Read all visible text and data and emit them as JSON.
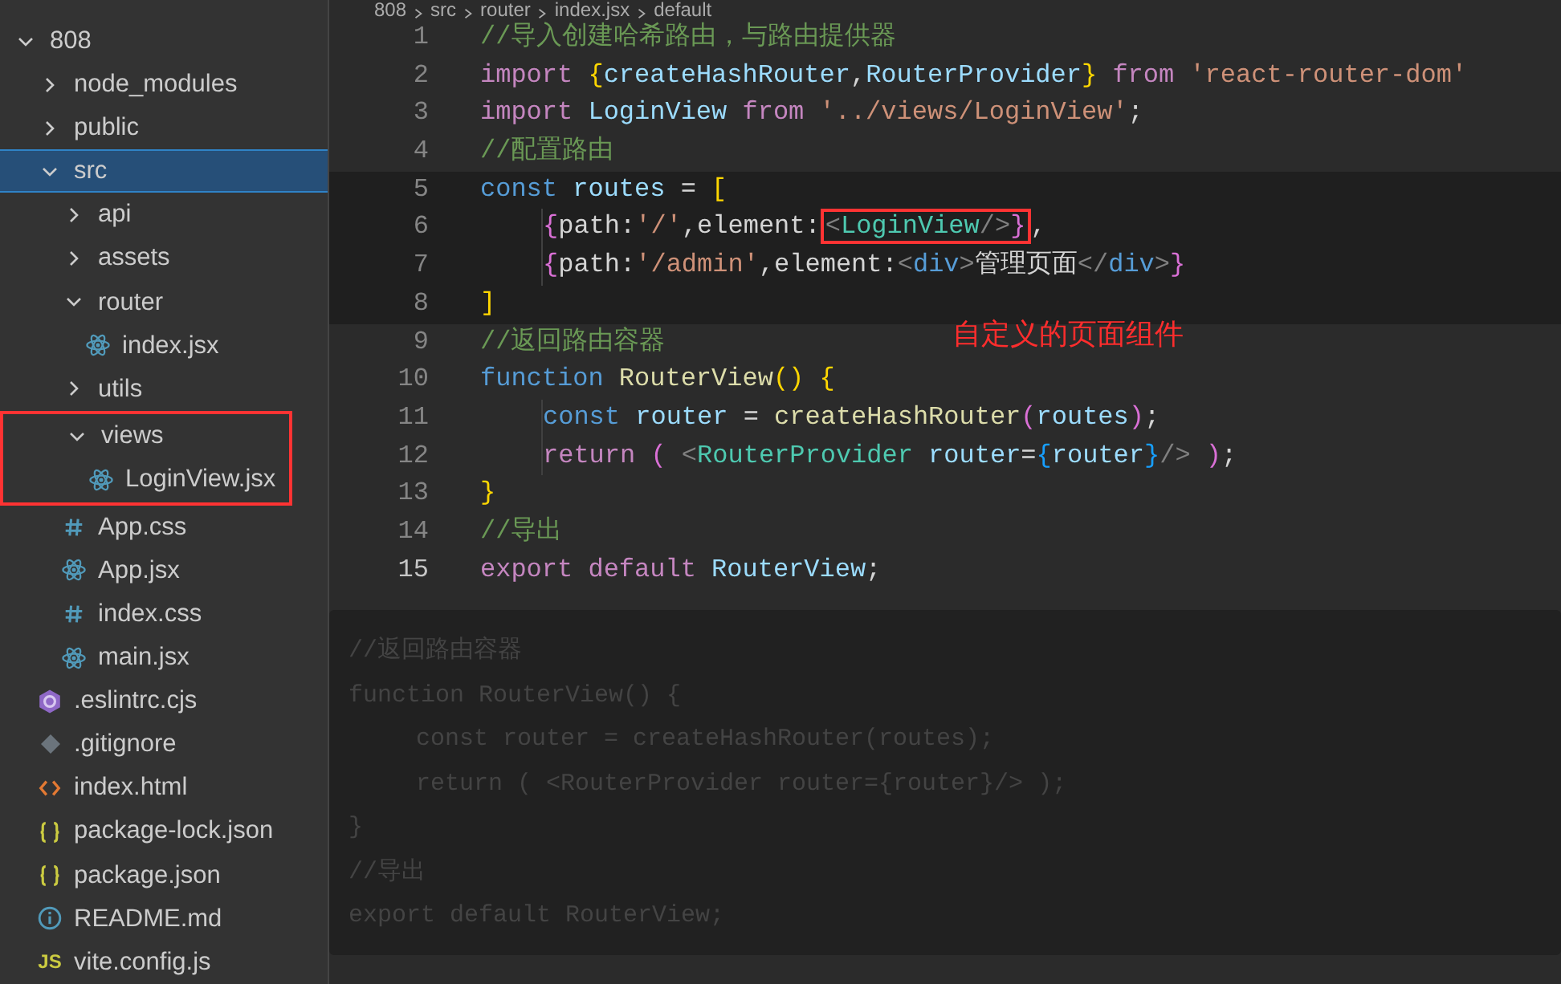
{
  "breadcrumb": [
    "808",
    "src",
    "router",
    "index.jsx",
    "default"
  ],
  "explorer": {
    "tree": [
      {
        "label": "808",
        "kind": "folder",
        "expanded": true,
        "selected": false,
        "children": [
          {
            "label": "node_modules",
            "kind": "folder",
            "expanded": false,
            "selected": false
          },
          {
            "label": "public",
            "kind": "folder",
            "expanded": false,
            "selected": false
          },
          {
            "label": "src",
            "kind": "folder",
            "expanded": true,
            "selected": true,
            "children": [
              {
                "label": "api",
                "kind": "folder",
                "expanded": false,
                "selected": false
              },
              {
                "label": "assets",
                "kind": "folder",
                "expanded": false,
                "selected": false
              },
              {
                "label": "router",
                "kind": "folder",
                "expanded": true,
                "selected": false,
                "children": [
                  {
                    "label": "index.jsx",
                    "kind": "react",
                    "selected": false
                  }
                ]
              },
              {
                "label": "utils",
                "kind": "folder",
                "expanded": false,
                "selected": false
              },
              {
                "label": "views",
                "kind": "folder",
                "expanded": true,
                "selected": false,
                "highlighted": true,
                "children": [
                  {
                    "label": "LoginView.jsx",
                    "kind": "react",
                    "selected": false
                  }
                ]
              },
              {
                "label": "App.css",
                "kind": "css",
                "selected": false
              },
              {
                "label": "App.jsx",
                "kind": "react",
                "selected": false
              },
              {
                "label": "index.css",
                "kind": "css",
                "selected": false
              },
              {
                "label": "main.jsx",
                "kind": "react",
                "selected": false
              }
            ]
          },
          {
            "label": ".eslintrc.cjs",
            "kind": "eslint",
            "selected": false
          },
          {
            "label": ".gitignore",
            "kind": "git",
            "selected": false
          },
          {
            "label": "index.html",
            "kind": "html",
            "selected": false
          },
          {
            "label": "package-lock.json",
            "kind": "json",
            "selected": false
          },
          {
            "label": "package.json",
            "kind": "json",
            "selected": false
          },
          {
            "label": "README.md",
            "kind": "info",
            "selected": false
          },
          {
            "label": "vite.config.js",
            "kind": "js",
            "badge": "JS",
            "selected": false
          }
        ]
      }
    ]
  },
  "editor": {
    "lines": [
      {
        "number": "1",
        "indented": false,
        "tokens": [
          {
            "text": "//导入创建哈希路由，与路由提供器",
            "kind": "comment"
          }
        ]
      },
      {
        "number": "2",
        "indented": false,
        "tokens": [
          {
            "text": "import ",
            "kind": "keyword"
          },
          {
            "text": "{",
            "kind": "bracket1"
          },
          {
            "text": "createHashRouter",
            "kind": "variable"
          },
          {
            "text": ",",
            "kind": "plain"
          },
          {
            "text": "RouterProvider",
            "kind": "variable"
          },
          {
            "text": "}",
            "kind": "bracket1"
          },
          {
            "text": " from ",
            "kind": "keyword"
          },
          {
            "text": "'react-router-dom'",
            "kind": "string"
          }
        ]
      },
      {
        "number": "3",
        "indented": false,
        "tokens": [
          {
            "text": "import ",
            "kind": "keyword"
          },
          {
            "text": "LoginView",
            "kind": "variable"
          },
          {
            "text": " from ",
            "kind": "keyword"
          },
          {
            "text": "'../views/LoginView'",
            "kind": "string"
          },
          {
            "text": ";",
            "kind": "plain"
          }
        ]
      },
      {
        "number": "4",
        "indented": false,
        "tokens": [
          {
            "text": "//配置路由",
            "kind": "comment"
          }
        ]
      },
      {
        "number": "5",
        "indented": false,
        "tokens": [
          {
            "text": "const ",
            "kind": "storage"
          },
          {
            "text": "routes",
            "kind": "variable"
          },
          {
            "text": " = ",
            "kind": "plain"
          },
          {
            "text": "[",
            "kind": "bracket1"
          }
        ]
      },
      {
        "number": "6",
        "indented": true,
        "tokens": [
          {
            "text": "{",
            "kind": "bracket2"
          },
          {
            "text": "path:",
            "kind": "plain"
          },
          {
            "text": "'/'",
            "kind": "string"
          },
          {
            "text": ",element:",
            "kind": "plain"
          },
          {
            "text": "<",
            "kind": "tagpunct",
            "boxed": true
          },
          {
            "text": "LoginView",
            "kind": "component",
            "boxed": true
          },
          {
            "text": "/>",
            "kind": "tagpunct",
            "boxed": true
          },
          {
            "text": "}",
            "kind": "bracket2",
            "boxed": true
          },
          {
            "text": ",",
            "kind": "plain"
          }
        ]
      },
      {
        "number": "7",
        "indented": true,
        "tokens": [
          {
            "text": "{",
            "kind": "bracket2"
          },
          {
            "text": "path:",
            "kind": "plain"
          },
          {
            "text": "'/admin'",
            "kind": "string"
          },
          {
            "text": ",element:",
            "kind": "plain"
          },
          {
            "text": "<",
            "kind": "tagpunct"
          },
          {
            "text": "div",
            "kind": "storage"
          },
          {
            "text": ">",
            "kind": "tagpunct"
          },
          {
            "text": "管理页面",
            "kind": "plain"
          },
          {
            "text": "</",
            "kind": "tagpunct"
          },
          {
            "text": "div",
            "kind": "storage"
          },
          {
            "text": ">",
            "kind": "tagpunct"
          },
          {
            "text": "}",
            "kind": "bracket2"
          }
        ]
      },
      {
        "number": "8",
        "indented": false,
        "tokens": [
          {
            "text": "]",
            "kind": "bracket1"
          }
        ]
      },
      {
        "number": "9",
        "indented": false,
        "tokens": [
          {
            "text": "//返回路由容器",
            "kind": "comment"
          }
        ]
      },
      {
        "number": "10",
        "indented": false,
        "tokens": [
          {
            "text": "function ",
            "kind": "storage"
          },
          {
            "text": "RouterView",
            "kind": "function"
          },
          {
            "text": "() {",
            "kind": "bracket1"
          }
        ]
      },
      {
        "number": "11",
        "indented": true,
        "tokens": [
          {
            "text": "const ",
            "kind": "storage"
          },
          {
            "text": "router",
            "kind": "variable"
          },
          {
            "text": " = ",
            "kind": "plain"
          },
          {
            "text": "createHashRouter",
            "kind": "function"
          },
          {
            "text": "(",
            "kind": "bracket2"
          },
          {
            "text": "routes",
            "kind": "variable"
          },
          {
            "text": ")",
            "kind": "bracket2"
          },
          {
            "text": ";",
            "kind": "plain"
          }
        ]
      },
      {
        "number": "12",
        "indented": true,
        "tokens": [
          {
            "text": "return ",
            "kind": "keyword"
          },
          {
            "text": "( ",
            "kind": "bracket2"
          },
          {
            "text": "<",
            "kind": "tagpunct"
          },
          {
            "text": "RouterProvider",
            "kind": "component"
          },
          {
            "text": " router",
            "kind": "variable"
          },
          {
            "text": "=",
            "kind": "plain"
          },
          {
            "text": "{",
            "kind": "bracket3"
          },
          {
            "text": "router",
            "kind": "variable"
          },
          {
            "text": "}",
            "kind": "bracket3"
          },
          {
            "text": "/>",
            "kind": "tagpunct"
          },
          {
            "text": " )",
            "kind": "bracket2"
          },
          {
            "text": ";",
            "kind": "plain"
          }
        ]
      },
      {
        "number": "13",
        "indented": false,
        "tokens": [
          {
            "text": "}",
            "kind": "bracket1"
          }
        ]
      },
      {
        "number": "14",
        "indented": false,
        "tokens": [
          {
            "text": "//导出",
            "kind": "comment"
          }
        ]
      },
      {
        "number": "15",
        "indented": false,
        "tokens": [
          {
            "text": "export default ",
            "kind": "keyword"
          },
          {
            "text": "RouterView",
            "kind": "variable"
          },
          {
            "text": ";",
            "kind": "plain"
          }
        ]
      }
    ],
    "annotation": "自定义的页面组件"
  },
  "background_code": [
    {
      "text": "//返回路由容器",
      "indented": false
    },
    {
      "text": "function RouterView() {",
      "indented": false
    },
    {
      "text": "const router = createHashRouter(routes);",
      "indented": true
    },
    {
      "text": "return ( <RouterProvider router={router}/> );",
      "indented": true
    },
    {
      "text": "}",
      "indented": false
    },
    {
      "text": "//导出",
      "indented": false
    },
    {
      "text": "export default RouterView;",
      "indented": false
    }
  ]
}
